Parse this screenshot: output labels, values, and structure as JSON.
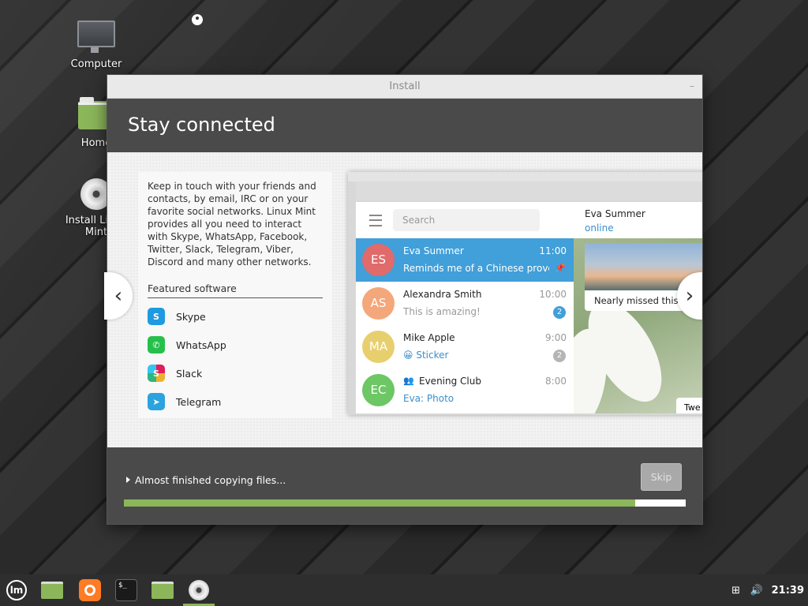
{
  "desktop": {
    "icons": [
      {
        "label": "Computer",
        "icon": "computer-icon"
      },
      {
        "label": "Home",
        "icon": "home-folder-icon"
      },
      {
        "label": "Install Linux Mint",
        "icon": "install-disc-icon"
      }
    ]
  },
  "window": {
    "title": "Install",
    "minimize_glyph": "–",
    "header_title": "Stay connected",
    "description": "Keep in touch with your friends and contacts, by email, IRC or on your favorite social networks. Linux Mint provides all you need to interact with Skype, WhatsApp, Facebook, Twitter, Slack, Telegram, Viber, Discord and many other networks.",
    "featured_title": "Featured software",
    "featured": [
      {
        "name": "Skype",
        "icon": "skype-icon",
        "glyph": "S"
      },
      {
        "name": "WhatsApp",
        "icon": "whatsapp-icon",
        "glyph": "✆"
      },
      {
        "name": "Slack",
        "icon": "slack-icon",
        "glyph": "S"
      },
      {
        "name": "Telegram",
        "icon": "telegram-icon",
        "glyph": "➤"
      }
    ],
    "prev_glyph": "‹",
    "next_glyph": "›",
    "status_text": "Almost finished copying files...",
    "skip_label": "Skip",
    "progress": 0.91
  },
  "telegram": {
    "search_placeholder": "Search",
    "chats": [
      {
        "initials": "ES",
        "name": "Eva Summer",
        "time": "11:00",
        "msg": "Reminds me of a Chinese prover...",
        "color": "#e16a6a",
        "active": true,
        "pinned": true
      },
      {
        "initials": "AS",
        "name": "Alexandra Smith",
        "time": "10:00",
        "msg": "This is amazing!",
        "color": "#f4a77a",
        "badge": "2",
        "badge_color": "#419fd9"
      },
      {
        "initials": "MA",
        "name": "Mike Apple",
        "time": "9:00",
        "msg": "😀 Sticker",
        "color": "#e8cf6e",
        "badge": "2",
        "badge_color": "#b5b5b5",
        "msg_blue": true
      },
      {
        "initials": "EC",
        "name": "Evening Club",
        "time": "8:00",
        "msg": "Eva: Photo",
        "color": "#6cc764",
        "msg_blue": true,
        "group": true
      }
    ],
    "contact_name": "Eva Summer",
    "contact_status": "online",
    "photo_caption": "Nearly missed this s",
    "bubble_text": "Twe"
  },
  "taskbar": {
    "clock": "21:39",
    "term_text": "$_",
    "mint_glyph": "lm"
  },
  "colors": {
    "accent": "#8cb65a",
    "telegram_blue": "#419fd9",
    "header_bg": "#4a4a4a"
  }
}
